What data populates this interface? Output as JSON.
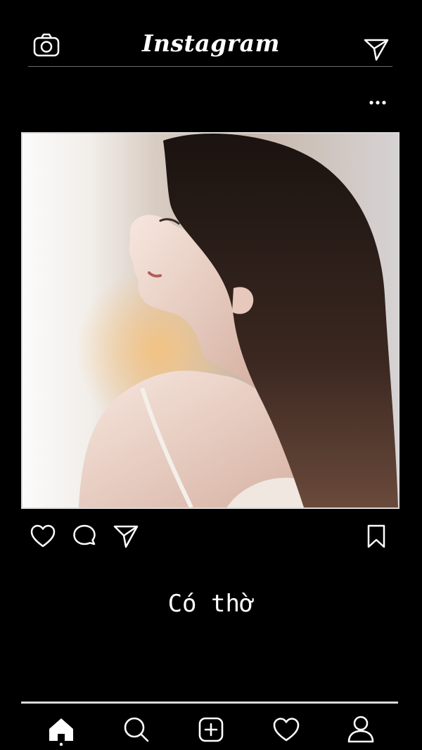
{
  "header": {
    "brand": "Instagram",
    "left_icon": "camera-icon",
    "right_icon": "send-icon"
  },
  "post": {
    "menu_icon": "more-options-icon",
    "photo_description_icon": "photo",
    "actions": [
      "heart-icon",
      "comment-icon",
      "send-icon",
      "bookmark-icon"
    ],
    "caption": "Có thờ"
  },
  "bottom_nav": {
    "items": [
      "home-icon",
      "search-icon",
      "add-post-icon",
      "heart-icon",
      "profile-icon"
    ]
  },
  "colors": {
    "background": "#000000",
    "foreground": "#ffffff",
    "divider": "#6b6b6b"
  }
}
